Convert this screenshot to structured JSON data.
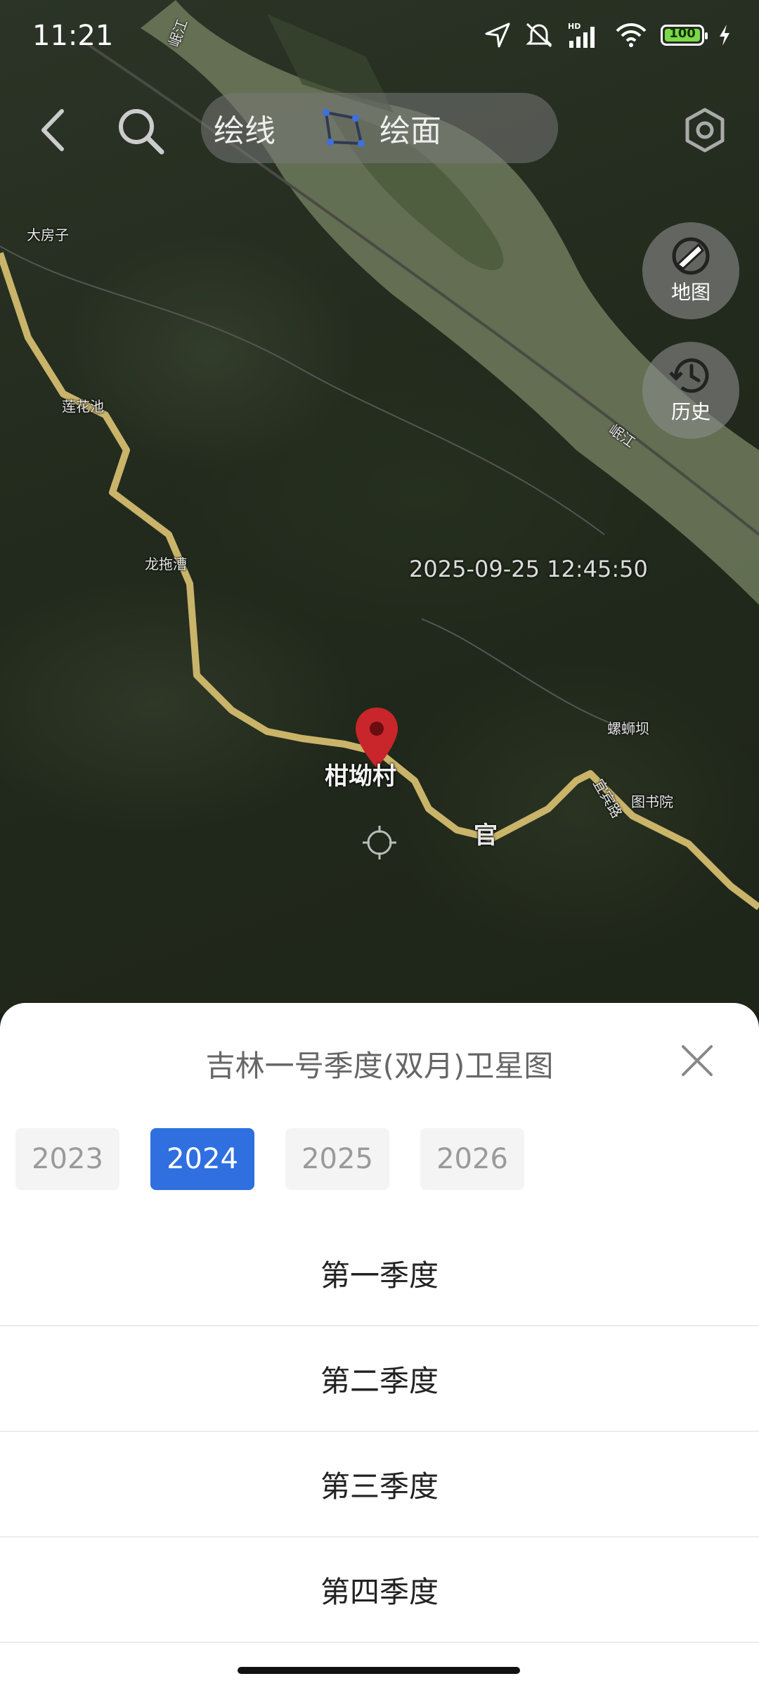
{
  "status_bar": {
    "time": "11:21",
    "battery": "100"
  },
  "toolbar": {
    "draw_line_label": "绘线",
    "draw_area_label": "绘面"
  },
  "side_buttons": {
    "map_label": "地图",
    "history_label": "历史"
  },
  "map": {
    "places": [
      "岷江",
      "大房子",
      "莲花池",
      "龙拖漕",
      "岷江",
      "螺蛳坝",
      "图书院",
      "宜宾路",
      "官"
    ],
    "timestamp": "2025-09-25 12:45:50",
    "pin_label": "柑坳村"
  },
  "sheet": {
    "title": "吉林一号季度(双月)卫星图",
    "years": [
      "2023",
      "2024",
      "2025",
      "2026"
    ],
    "selected_year": "2024",
    "seasons": [
      "第一季度",
      "第二季度",
      "第三季度",
      "第四季度"
    ]
  },
  "colors": {
    "accent": "#2f6fe0",
    "river": "#6f7a5c",
    "road": "#c9b46a"
  },
  "icons": [
    "back-icon",
    "search-icon",
    "polygon-icon",
    "settings-icon",
    "map-layer-icon",
    "history-icon",
    "close-icon",
    "location-pin-icon",
    "crosshair-icon",
    "navigation-arrow-icon",
    "mute-icon",
    "signal-icon",
    "wifi-icon",
    "battery-icon",
    "charging-icon"
  ]
}
